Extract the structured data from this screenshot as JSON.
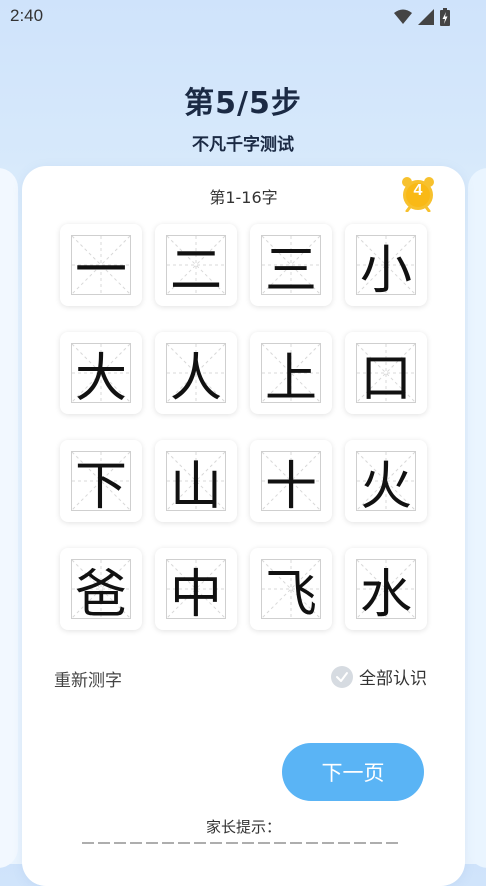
{
  "status_bar": {
    "time": "2:40"
  },
  "header": {
    "title": "第5/5步",
    "subtitle": "不凡千字测试"
  },
  "card": {
    "heading": "第1-16字",
    "timer": "4",
    "characters": [
      "一",
      "二",
      "三",
      "小",
      "大",
      "人",
      "上",
      "口",
      "下",
      "山",
      "十",
      "火",
      "爸",
      "中",
      "飞",
      "水"
    ]
  },
  "actions": {
    "retest_label": "重新测字",
    "all_known_label": "全部认识",
    "next_label": "下一页"
  },
  "footer": {
    "tip_label": "家长提示："
  },
  "colors": {
    "accent": "#5ab4f5",
    "timer": "#f7c12e",
    "background": "#d7e9fb"
  }
}
